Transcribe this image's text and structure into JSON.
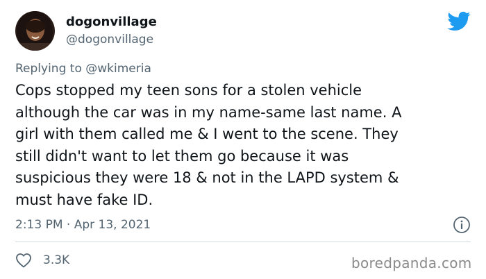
{
  "tweet": {
    "author": {
      "display_name": "dogonvillage",
      "handle": "@dogonvillage",
      "avatar_icon": "profile-photo"
    },
    "platform_icon": "twitter-bird-icon",
    "accent_color": "#1d9bf0",
    "reply": {
      "prefix": "Replying to ",
      "mention": "@wkimeria"
    },
    "text_lines": [
      "Cops stopped my teen sons for a stolen vehicle",
      "although the car was in my name-same last name. A",
      "girl with them called me & I went to the scene. They",
      "still didn't want to let them go because it was",
      "suspicious they were 18 & not in the LAPD system &",
      "must have fake ID."
    ],
    "timestamp": "2:13 PM · Apr 13, 2021",
    "likes": "3.3K"
  },
  "watermark": "boredpanda.com"
}
